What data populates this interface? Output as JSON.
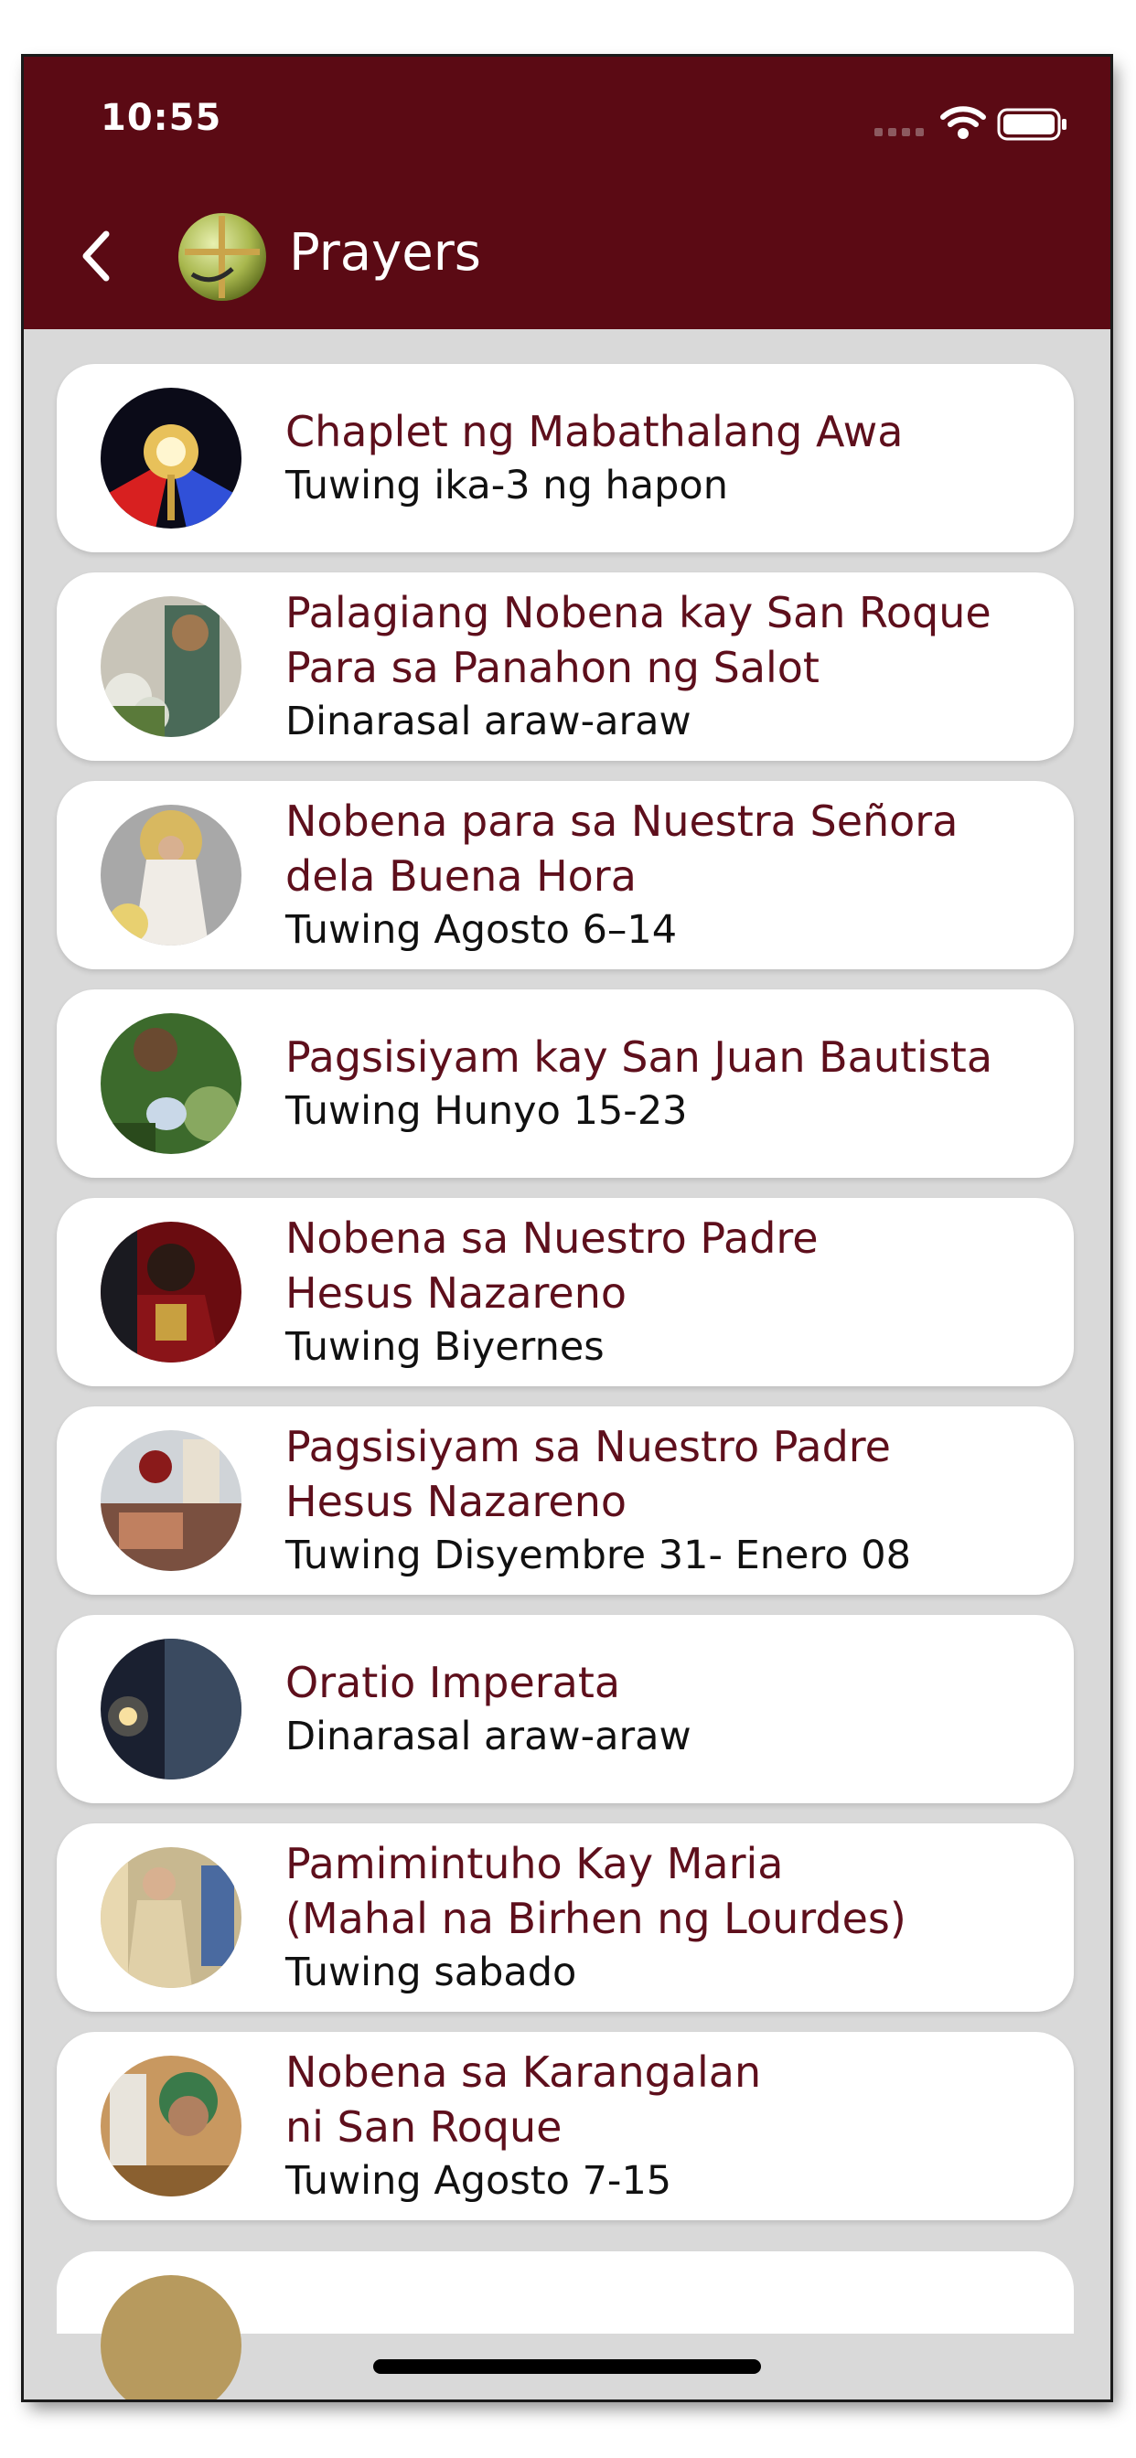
{
  "status_bar": {
    "time": "10:55"
  },
  "header": {
    "title": "Prayers",
    "accent": "#5b0a14"
  },
  "colors": {
    "item_title": "#5e0f1c",
    "item_subtitle": "#111111",
    "list_bg": "#d9d9d9"
  },
  "items": [
    {
      "title": "Chaplet ng Mabathalang Awa",
      "subtitle": "Tuwing ika-3 ng hapon"
    },
    {
      "title": "Palagiang Nobena kay San Roque\nPara sa Panahon ng Salot",
      "subtitle": "Dinarasal araw-araw"
    },
    {
      "title": "Nobena para sa Nuestra Señora\ndela Buena Hora",
      "subtitle": "Tuwing Agosto 6–14"
    },
    {
      "title": "Pagsisiyam kay San Juan Bautista",
      "subtitle": "Tuwing Hunyo 15-23"
    },
    {
      "title": "Nobena sa Nuestro Padre\nHesus Nazareno",
      "subtitle": "Tuwing Biyernes"
    },
    {
      "title": "Pagsisiyam sa Nuestro Padre\nHesus Nazareno",
      "subtitle": "Tuwing Disyembre 31- Enero 08"
    },
    {
      "title": "Oratio Imperata",
      "subtitle": "Dinarasal araw-araw"
    },
    {
      "title": "Pamimintuho Kay Maria\n(Mahal na Birhen ng Lourdes)",
      "subtitle": "Tuwing sabado"
    },
    {
      "title": "Nobena sa Karangalan\n ni San Roque",
      "subtitle": "Tuwing Agosto 7-15"
    }
  ]
}
